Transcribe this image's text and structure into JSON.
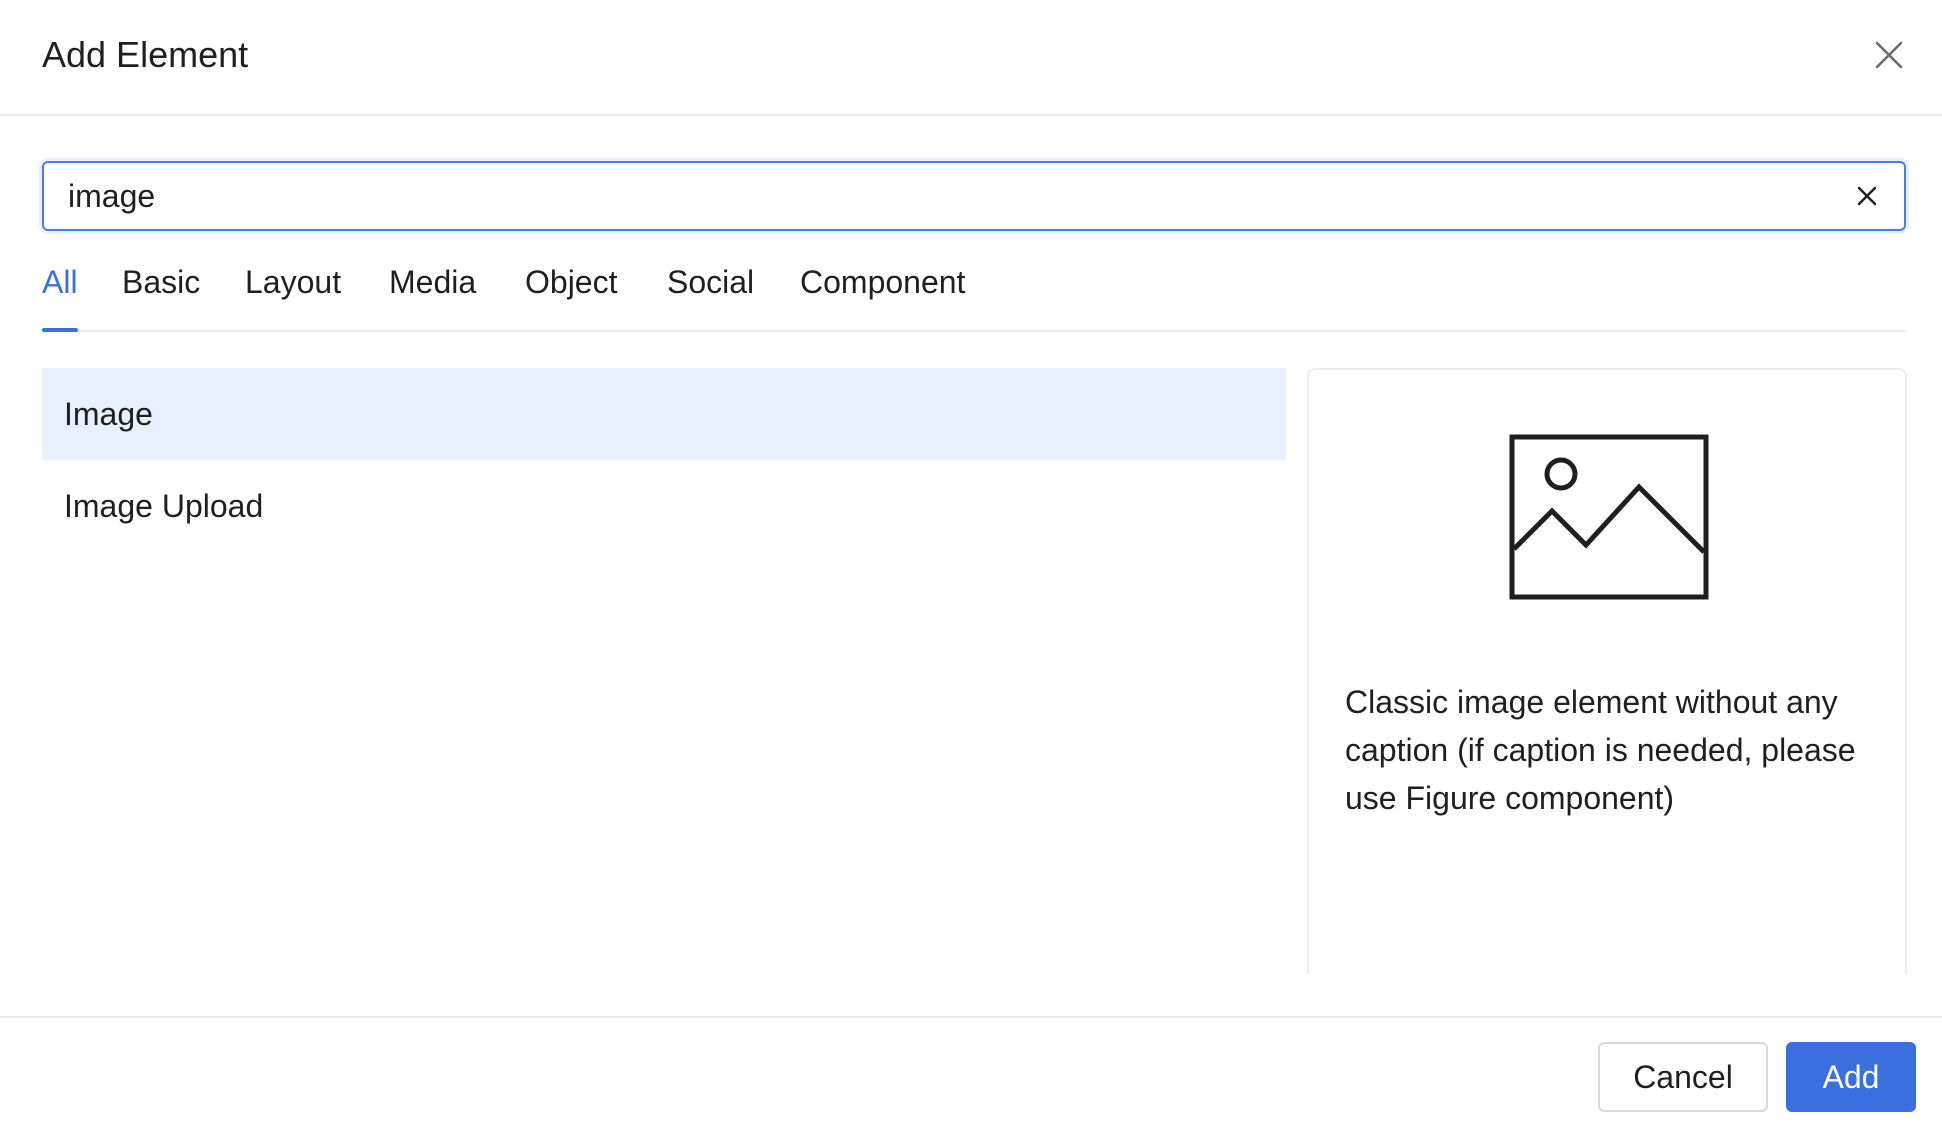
{
  "dialog": {
    "title": "Add Element"
  },
  "search": {
    "value": "image",
    "placeholder": ""
  },
  "tabs": [
    {
      "label": "All",
      "active": true
    },
    {
      "label": "Basic",
      "active": false
    },
    {
      "label": "Layout",
      "active": false
    },
    {
      "label": "Media",
      "active": false
    },
    {
      "label": "Object",
      "active": false
    },
    {
      "label": "Social",
      "active": false
    },
    {
      "label": "Component",
      "active": false
    }
  ],
  "results": [
    {
      "label": "Image",
      "selected": true
    },
    {
      "label": "Image Upload",
      "selected": false
    }
  ],
  "preview": {
    "icon": "image-placeholder-icon",
    "description": "Classic image element without any caption (if caption is needed, please use Figure component)"
  },
  "footer": {
    "cancel_label": "Cancel",
    "add_label": "Add"
  },
  "colors": {
    "accent": "#3b6fe0",
    "selected_bg": "#e9f0fd",
    "border": "#ececec"
  }
}
